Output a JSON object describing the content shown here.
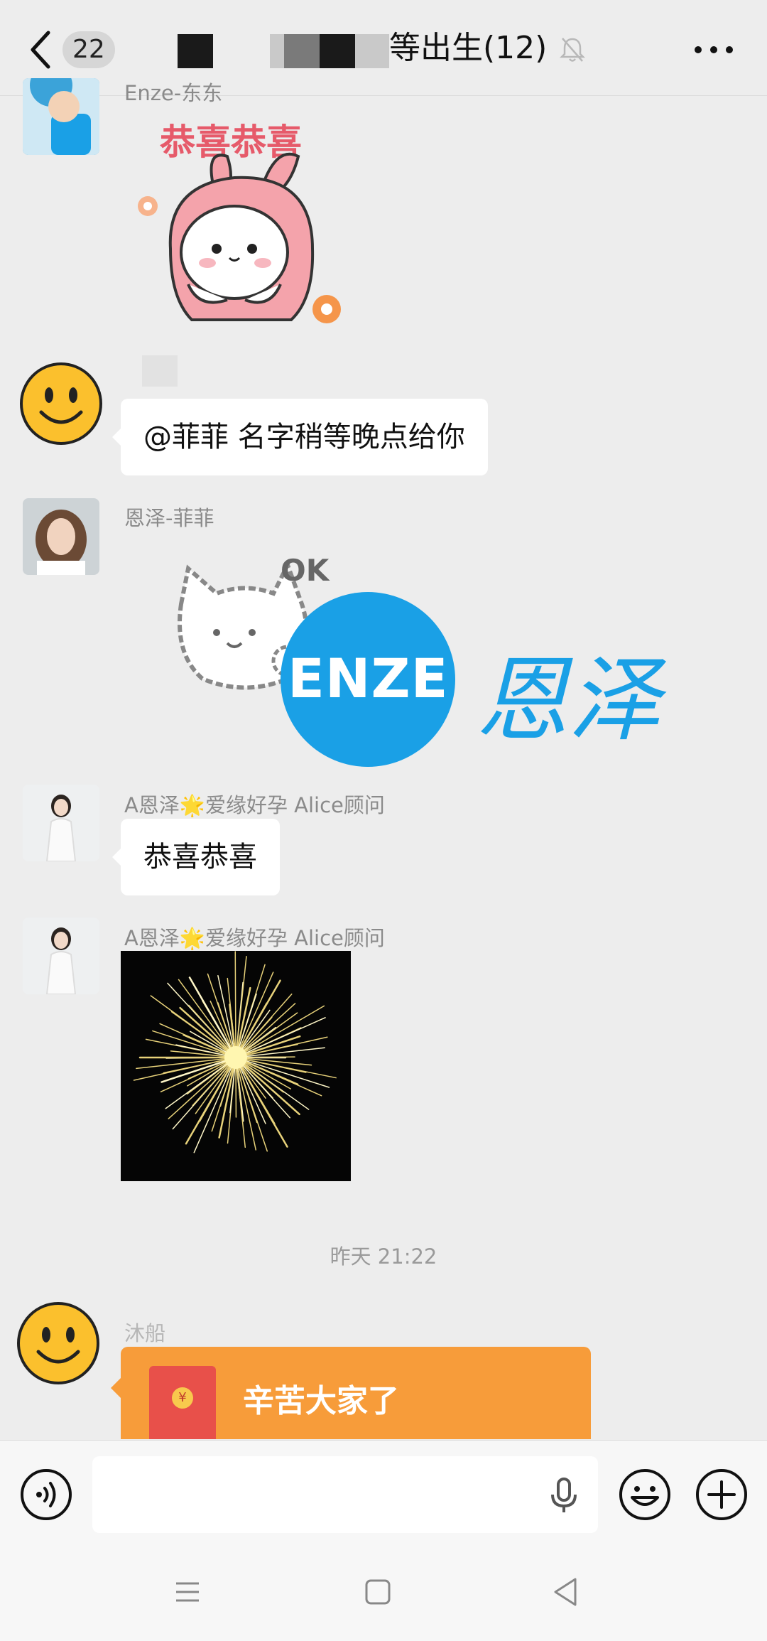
{
  "header": {
    "unread_count": "22",
    "title": "等出生(12)"
  },
  "messages": [
    {
      "sender": "Enze-东东",
      "type": "sticker",
      "sticker_text": "恭喜恭喜"
    },
    {
      "sender": "",
      "type": "text",
      "text": "@菲菲   名字稍等晚点给你"
    },
    {
      "sender": "恩泽-菲菲",
      "type": "sticker",
      "sticker_caption": "OK",
      "logo_text": "ENZE",
      "logo_cn": "恩泽"
    },
    {
      "sender": "A恩泽🌟爱缘好孕 Alice顾问",
      "type": "text",
      "text": "恭喜恭喜"
    },
    {
      "sender": "A恩泽🌟爱缘好孕 Alice顾问",
      "type": "image"
    }
  ],
  "timestamp": "昨天 21:22",
  "red_packet": {
    "sender": "沐船",
    "text": "辛苦大家了",
    "coin_symbol": "¥"
  },
  "input": {
    "placeholder": ""
  },
  "colors": {
    "background": "#ededed",
    "bubble": "#ffffff",
    "red_packet": "#f79c3a",
    "enze_blue": "#1aa0e6"
  }
}
